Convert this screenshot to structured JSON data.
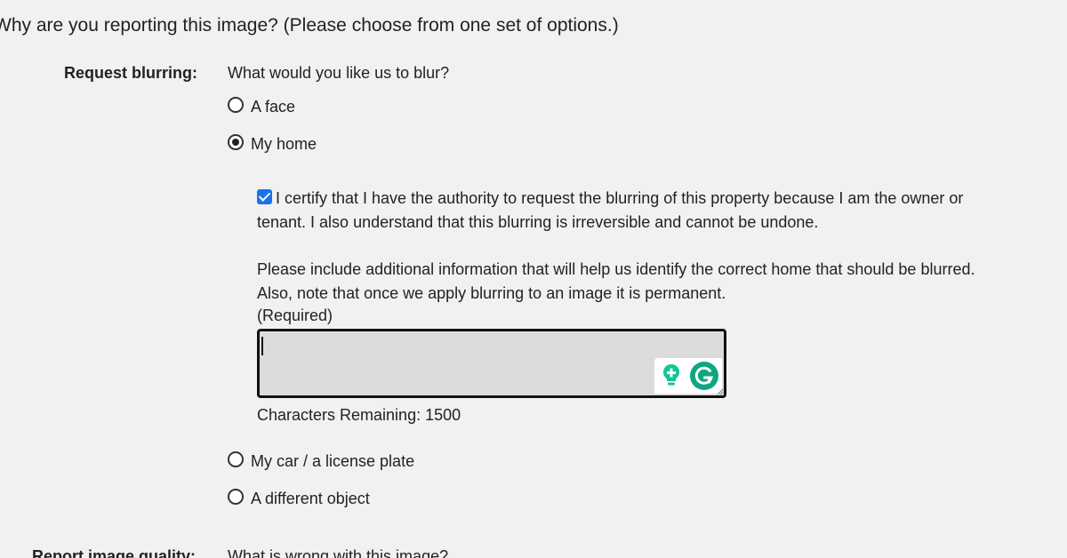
{
  "question": "Why are you reporting this image?  (Please choose from one set of options.)",
  "blur_section": {
    "label": "Request blurring:",
    "prompt": "What would you like us to blur?",
    "options": [
      {
        "label": "A face",
        "checked": false
      },
      {
        "label": "My home",
        "checked": true
      },
      {
        "label": "My car / a license plate",
        "checked": false
      },
      {
        "label": "A different object",
        "checked": false
      }
    ],
    "certify_text": "I certify that I have the authority to request the blurring of this property because I am the owner or tenant. I also understand that this blurring is irreversible and cannot be undone.",
    "certify_checked": true,
    "info_text": "Please include additional information that will help us identify the correct home that should be blurred. Also, note that once we apply blurring to an image it is permanent.",
    "required_text": "(Required)",
    "textarea_value": "",
    "characters_remaining": "Characters Remaining: 1500"
  },
  "quality_section": {
    "label": "Report image quality:",
    "prompt": "What is wrong with this image?"
  },
  "colors": {
    "background": "#f1f1f2",
    "checkbox": "#1a73e8",
    "grammarly": "#15c39a",
    "grammarly_logo": "#11a683",
    "textarea_bg": "#dcdcdf"
  },
  "icons": {
    "grammarly_suggestion": "lightbulb-plus-icon",
    "grammarly_logo": "grammarly-g-icon",
    "resize_handle": "resize-grip-icon"
  }
}
